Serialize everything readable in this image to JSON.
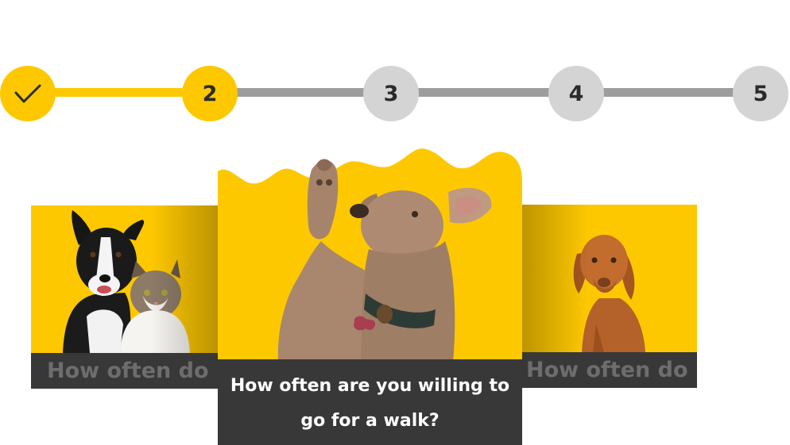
{
  "stepper": {
    "steps": [
      {
        "label": "",
        "state": "completed",
        "icon": "check-icon"
      },
      {
        "label": "2",
        "state": "current"
      },
      {
        "label": "3",
        "state": "upcoming"
      },
      {
        "label": "4",
        "state": "upcoming"
      },
      {
        "label": "5",
        "state": "upcoming"
      }
    ]
  },
  "colors": {
    "accent": "#fec800",
    "track_inactive": "#9d9d9d",
    "step_inactive": "#d4d4d4",
    "caption_bg": "#383838"
  },
  "cards": {
    "left": {
      "caption": "How often do",
      "image": "dog-and-cat-photo"
    },
    "center": {
      "caption": "How often are you willing to go for a walk?",
      "image": "dog-raising-paw-photo"
    },
    "right": {
      "caption": "How often do",
      "image": "vizsla-dog-photo"
    }
  }
}
